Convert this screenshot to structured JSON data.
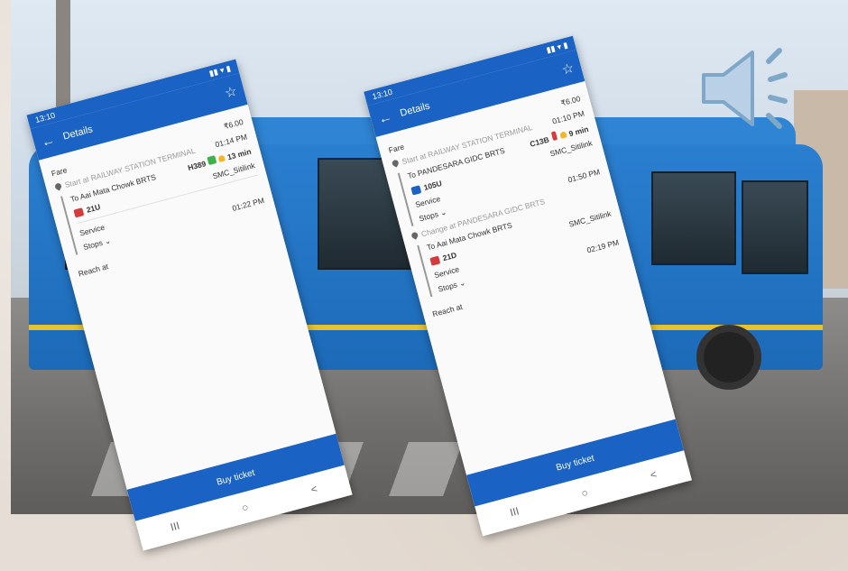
{
  "phone1": {
    "status_time": "13:10",
    "title": "Details",
    "fare_label": "Fare",
    "fare_value": "₹6.00",
    "start_label": "Start at RAILWAY STATION TERMINAL",
    "start_time": "01:14 PM",
    "destination": "To Aai Mata Chowk BRTS",
    "vehicle": "H389",
    "eta": "13 min",
    "route": "21U",
    "operator": "SMC_Sitilink",
    "service_label": "Service",
    "stops_label": "Stops",
    "reach_label": "Reach at",
    "reach_time": "01:22 PM",
    "buy_label": "Buy ticket",
    "nav": [
      "III",
      "○",
      "<"
    ]
  },
  "phone2": {
    "status_time": "13:10",
    "title": "Details",
    "fare_label": "Fare",
    "fare_value": "₹6.00",
    "start_label": "Start at RAILWAY STATION TERMINAL",
    "start_time": "01:10 PM",
    "destination1": "To PANDESARA GIDC BRTS",
    "vehicle": "C13B",
    "eta": "9 min",
    "route1": "105U",
    "operator1": "SMC_Sitilink",
    "service_label": "Service",
    "stops_label": "Stops",
    "change_time": "01:50 PM",
    "change_label": "Change at PANDESARA GIDC BRTS",
    "destination2": "To Aai Mata Chowk BRTS",
    "route2": "21D",
    "operator2": "SMC_Sitilink",
    "reach_label": "Reach at",
    "reach_time": "02:19 PM",
    "buy_label": "Buy ticket",
    "nav": [
      "III",
      "○",
      "<"
    ]
  }
}
